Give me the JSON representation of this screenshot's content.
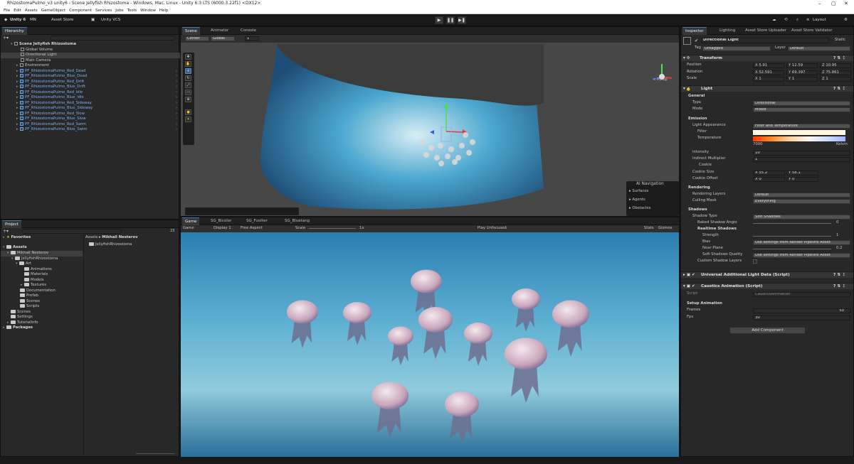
{
  "window": {
    "title": "RhizostomaPulmo_v3 unity6 - Scene Jellyfish Rhizostoma - Windows, Mac, Linux - Unity 6.3 LTS (6000.3.22f1) <DX12>"
  },
  "menu": [
    "File",
    "Edit",
    "Assets",
    "GameObject",
    "Component",
    "Services",
    "Jobs",
    "Tools",
    "Window",
    "Help"
  ],
  "toolbar": {
    "unity": "Unity 6",
    "account": "MN",
    "asset_store": "Asset Store",
    "vcs": "Unity VCS",
    "layout": "Layout"
  },
  "hierarchy": {
    "tab": "Hierarchy",
    "scene": "Scene Jellyfish Rhizostoma",
    "items": [
      "Global Volume",
      "Directional Light",
      "Main Camera",
      "Environment"
    ],
    "prefabs": [
      "PF_RhizostomaPulmo_Red_Dead",
      "PF_RhizostomaPulmo_Blue_Dead",
      "PF_RhizostomaPulmo_Red_Drift",
      "PF_RhizostomaPulmo_Blue_Drift",
      "PF_RhizostomaPulmo_Red_Idle",
      "PF_RhizostomaPulmo_Blue_Idle",
      "PF_RhizostomaPulmo_Red_Sideway",
      "PF_RhizostomaPulmo_Blue_Sideway",
      "PF_RhizostomaPulmo_Red_Slow",
      "PF_RhizostomaPulmo_Blue_Slow",
      "PF_RhizostomaPulmo_Red_Swim",
      "PF_RhizostomaPulmo_Blue_Swim"
    ]
  },
  "project": {
    "tab": "Project",
    "count": "23",
    "favorites": "Favorites",
    "assets": "Assets",
    "tree": [
      "Mikhail Nesterov",
      "JellyfishRhizostoma",
      "Art",
      "Animations",
      "Materials",
      "Models",
      "Textures",
      "Documentation",
      "Prefab",
      "Scenes",
      "Scripts",
      "Scenes",
      "Settings",
      "TutorialInfo",
      "Packages"
    ],
    "breadcrumb": [
      "Assets",
      "Mikhail Nesterov"
    ],
    "folder_item": "JellyfishRhizostoma"
  },
  "scene": {
    "tabs": [
      "Scene",
      "Animator",
      "Console"
    ],
    "pivot": "Center",
    "space": "Global",
    "persp": "< Persp",
    "nav": {
      "title": "AI Navigation",
      "items": [
        "Surfaces",
        "Agents",
        "Obstacles"
      ]
    }
  },
  "game": {
    "tabs": [
      "Game",
      "SG_Bicolor",
      "SG_Fusilier",
      "SG_Bluetang"
    ],
    "mode": "Game",
    "display": "Display 1",
    "aspect": "Free Aspect",
    "scale_label": "Scale",
    "scale_value": "1x",
    "play_focus": "Play Unfocused",
    "stats": "Stats",
    "gizmos": "Gizmos"
  },
  "inspector": {
    "tabs": [
      "Inspector",
      "Lighting",
      "Asset Store Uploader",
      "Asset Store Validator"
    ],
    "name": "Directional Light",
    "static": "Static",
    "tag_label": "Tag",
    "tag": "Untagged",
    "layer_label": "Layer",
    "layer": "Default",
    "transform": {
      "title": "Transform",
      "rows": [
        {
          "label": "Position",
          "x": "5.91",
          "y": "12.59",
          "z": "10.95"
        },
        {
          "label": "Rotation",
          "x": "52.591",
          "y": "69.397",
          "z": "75.861"
        },
        {
          "label": "Scale",
          "x": "1",
          "y": "1",
          "z": "1"
        }
      ]
    },
    "light": {
      "title": "Light",
      "general": "General",
      "type_label": "Type",
      "type": "Directional",
      "mode_label": "Mode",
      "mode": "Mixed",
      "emission": "Emission",
      "appearance_label": "Light Appearance",
      "appearance": "Filter and Temperature",
      "filter_label": "Filter",
      "temp_label": "Temperature",
      "temp_value": "7000",
      "kelvin": "Kelvin",
      "intensity_label": "Intensity",
      "intensity": "10",
      "indirect_label": "Indirect Multiplier",
      "indirect": "1",
      "cookie_label": "Cookie",
      "cookie_size_label": "Cookie Size",
      "cookie_size_x": "55.2",
      "cookie_size_y": "58.1",
      "cookie_offset_label": "Cookie Offset",
      "cookie_offset_x": "0",
      "cookie_offset_y": "0",
      "rendering": "Rendering",
      "rendering_layers_label": "Rendering Layers",
      "rendering_layers": "Default",
      "culling_label": "Culling Mask",
      "culling": "Everything",
      "shadows": "Shadows",
      "shadow_type_label": "Shadow Type",
      "shadow_type": "Soft Shadows",
      "baked_angle_label": "Baked Shadow Angle",
      "baked_angle": "0",
      "realtime": "Realtime Shadows",
      "strength_label": "Strength",
      "strength": "1",
      "bias_label": "Bias",
      "bias": "Use settings from Render Pipeline Asset",
      "near_label": "Near Plane",
      "near": "0.2",
      "quality_label": "Soft Shadows Quality",
      "quality": "Use settings from Render Pipeline Asset",
      "custom_label": "Custom Shadow Layers"
    },
    "urp": "Universal Additional Light Data (Script)",
    "caustics": "Caustics Animation (Script)",
    "script_label": "Script",
    "script": "CausticsAnimation",
    "setup": "Setup Animation",
    "frames_label": "Frames",
    "frames": "50",
    "fps_label": "Fps",
    "fps": "30",
    "add_component": "Add Component"
  },
  "colors": {
    "accent": "#3a79bb",
    "panel": "#282828",
    "water": "#3a8fc0"
  }
}
